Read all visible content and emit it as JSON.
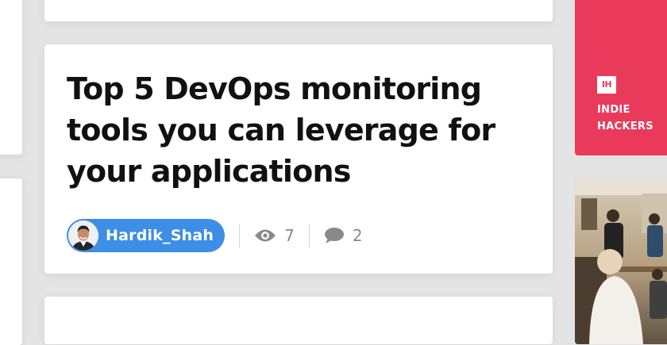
{
  "post": {
    "title": "Top 5 DevOps monitoring tools you can leverage for your applications",
    "author": "Hardik_Shah",
    "views": "7",
    "comments": "2"
  },
  "sidebar_promo": {
    "logo_text": "IH",
    "label": "INDIE HACKERS",
    "color": "#ea3a5b"
  },
  "colors": {
    "author_chip": "#3d8ee6",
    "title": "#111111",
    "stat": "#888888"
  },
  "icons": {
    "views": "eye-icon",
    "comments": "speech-bubble-icon"
  }
}
